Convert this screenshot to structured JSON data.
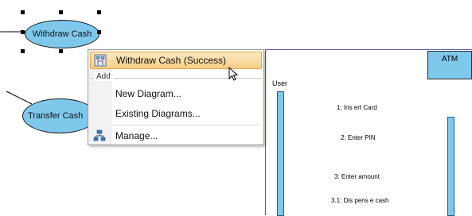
{
  "use_cases": {
    "withdraw": "Withdraw Cash",
    "transfer": "Transfer Cash"
  },
  "context_menu": {
    "top_item": "Withdraw Cash (Success)",
    "section_header": "Add",
    "items": [
      "New Diagram...",
      "Existing Diagrams..."
    ],
    "manage": "Manage..."
  },
  "sequence": {
    "actor_label": "User",
    "lifeline_box": "ATM",
    "messages": [
      "1: Ins ert Card",
      "2: Enter PIN",
      "3: Enter amount",
      "3.1: Dis pens e cash"
    ]
  },
  "colors": {
    "usecase_fill": "#7ec8ec",
    "menu_highlight": "#f6cf86"
  }
}
